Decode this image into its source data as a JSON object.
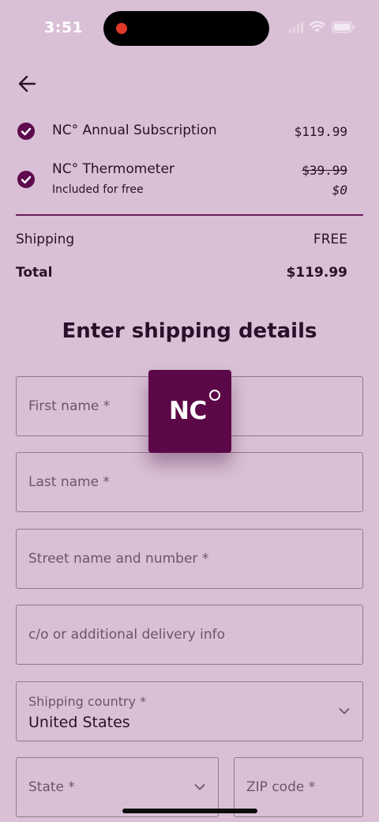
{
  "status_bar": {
    "time": "3:51"
  },
  "order": {
    "items": [
      {
        "name": "NC° Annual Subscription",
        "price": "$119.99"
      },
      {
        "name": "NC° Thermometer",
        "subtitle": "Included for free",
        "original_price": "$39.99",
        "price": "$0"
      }
    ],
    "shipping_label": "Shipping",
    "shipping_value": "FREE",
    "total_label": "Total",
    "total_value": "$119.99"
  },
  "form": {
    "heading": "Enter shipping details",
    "first_name": "First name *",
    "last_name": "Last name *",
    "street": "Street name and number *",
    "co_info": "c/o or additional delivery info",
    "country_label": "Shipping country *",
    "country_value": "United States",
    "state": "State *",
    "zip": "ZIP code *"
  },
  "logo": {
    "text": "NC"
  },
  "colors": {
    "background": "#d9c0d6",
    "brand": "#5c0848",
    "text": "#2b1029"
  }
}
